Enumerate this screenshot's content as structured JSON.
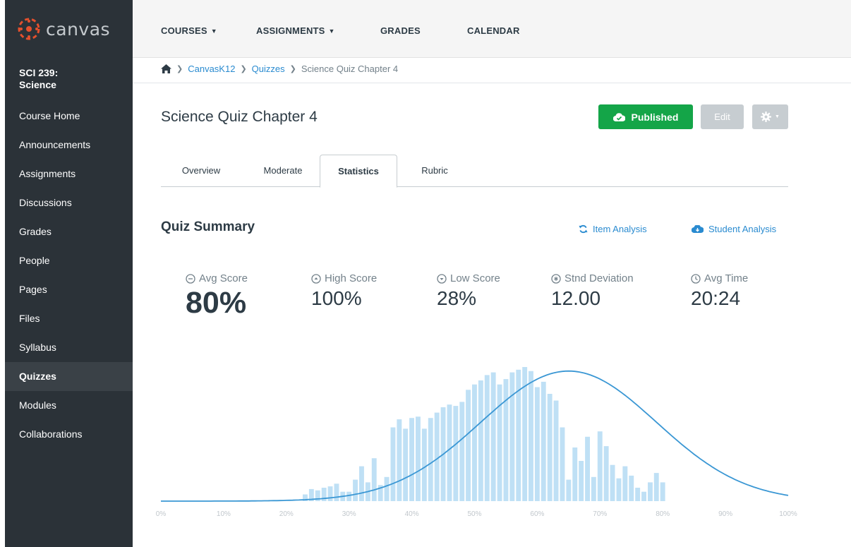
{
  "app": {
    "name": "canvas"
  },
  "course": {
    "title_line1": "SCI 239:",
    "title_line2": "Science"
  },
  "sidebar": {
    "items": [
      {
        "label": "Course Home"
      },
      {
        "label": "Announcements"
      },
      {
        "label": "Assignments"
      },
      {
        "label": "Discussions"
      },
      {
        "label": "Grades"
      },
      {
        "label": "People"
      },
      {
        "label": "Pages"
      },
      {
        "label": "Files"
      },
      {
        "label": "Syllabus"
      },
      {
        "label": "Quizzes",
        "active": true
      },
      {
        "label": "Modules"
      },
      {
        "label": "Collaborations"
      }
    ]
  },
  "topnav": {
    "courses": "COURSES",
    "assignments": "ASSIGNMENTS",
    "grades": "GRADES",
    "calendar": "CALENDAR"
  },
  "breadcrumb": {
    "item1": "CanvasK12",
    "item2": "Quizzes",
    "item3": "Science Quiz Chapter 4"
  },
  "page": {
    "title": "Science Quiz Chapter 4",
    "published_label": "Published",
    "edit_label": "Edit"
  },
  "tabs": {
    "overview": "Overview",
    "moderate": "Moderate",
    "statistics": "Statistics",
    "rubric": "Rubric"
  },
  "summary": {
    "title": "Quiz Summary",
    "item_analysis": "Item Analysis",
    "student_analysis": "Student Analysis",
    "avg_score_label": "Avg Score",
    "avg_score_value": "80%",
    "high_score_label": "High Score",
    "high_score_value": "100%",
    "low_score_label": "Low Score",
    "low_score_value": "28%",
    "std_dev_label": "Stnd Deviation",
    "std_dev_value": "12.00",
    "avg_time_label": "Avg Time",
    "avg_time_value": "20:24"
  },
  "colors": {
    "sidebar_bg": "#2b3238",
    "published_green": "#14a548",
    "link_blue": "#2a8bd0",
    "bar_fill": "#bfe0f5",
    "curve": "#3a97d4"
  },
  "chart_data": {
    "type": "bar",
    "x_ticks": [
      "0%",
      "10%",
      "20%",
      "30%",
      "40%",
      "50%",
      "60%",
      "70%",
      "80%",
      "90%",
      "100%"
    ],
    "xlim": [
      0,
      100
    ],
    "ylim": [
      0,
      1
    ],
    "bar_start": 23,
    "bar_step": 1,
    "values": [
      0.05,
      0.09,
      0.08,
      0.1,
      0.11,
      0.13,
      0.07,
      0.07,
      0.16,
      0.26,
      0.14,
      0.32,
      0.12,
      0.18,
      0.55,
      0.61,
      0.54,
      0.62,
      0.63,
      0.54,
      0.62,
      0.66,
      0.7,
      0.72,
      0.71,
      0.74,
      0.83,
      0.87,
      0.9,
      0.94,
      0.96,
      0.87,
      0.91,
      0.96,
      0.98,
      1.0,
      0.97,
      0.85,
      0.89,
      0.8,
      0.75,
      0.55,
      0.16,
      0.4,
      0.3,
      0.48,
      0.18,
      0.52,
      0.41,
      0.27,
      0.17,
      0.26,
      0.19,
      0.1,
      0.07,
      0.14,
      0.21,
      0.14
    ],
    "curve": {
      "type": "normal",
      "mean": 65,
      "sd": 14,
      "peak": 0.97
    },
    "grid": false
  }
}
